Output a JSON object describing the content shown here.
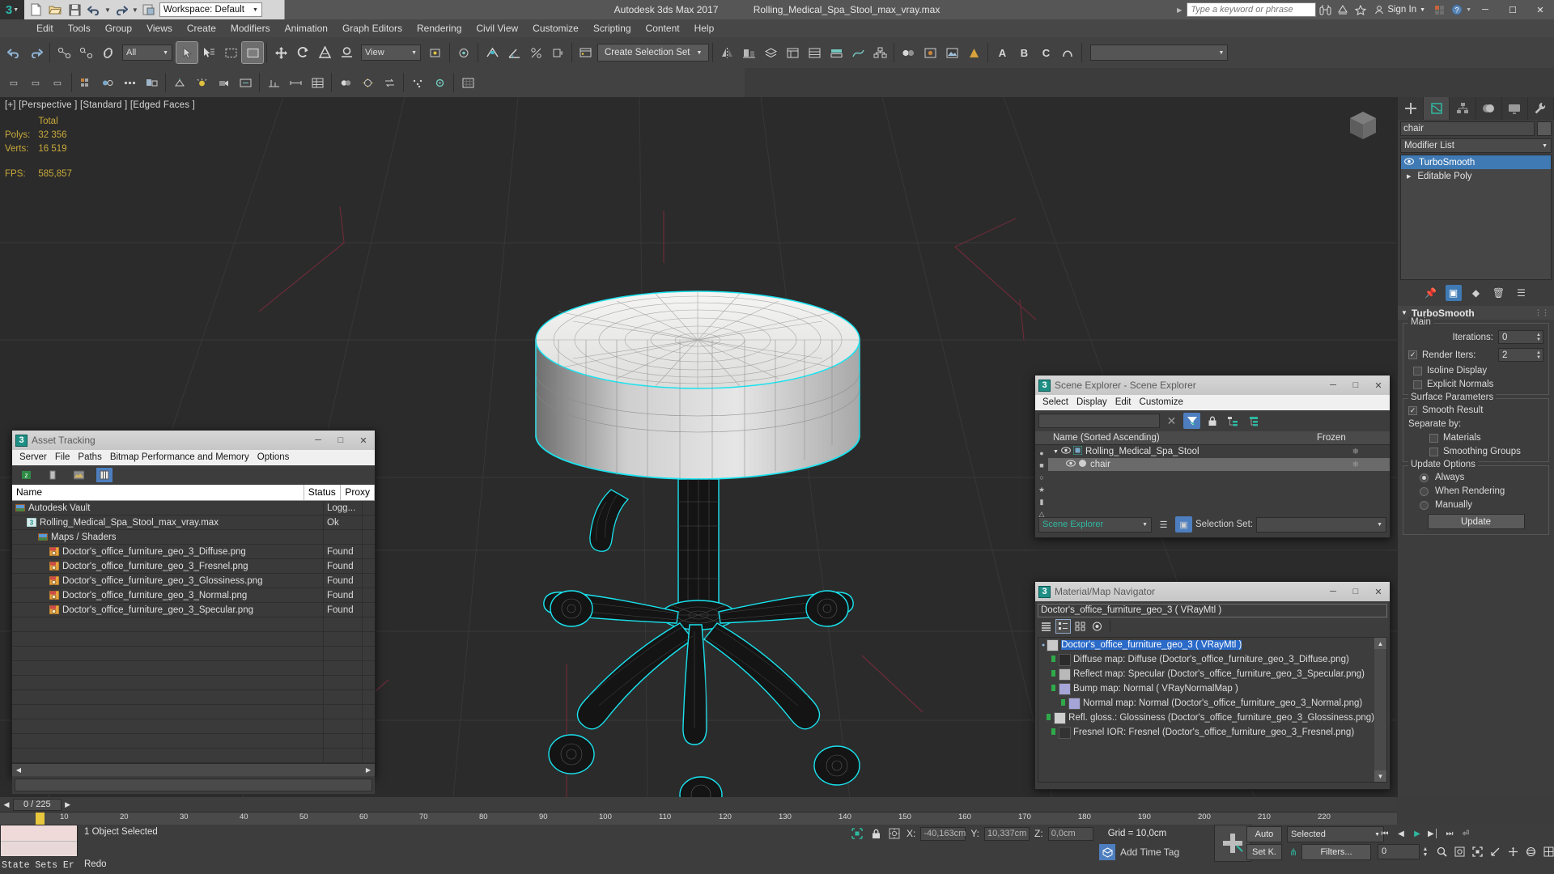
{
  "titlebar": {
    "app_icon": "3dsmax-logo-icon",
    "workspace_label": "Workspace: Default",
    "app_title": "Autodesk 3ds Max 2017",
    "file_name": "Rolling_Medical_Spa_Stool_max_vray.max",
    "search_placeholder": "Type a keyword or phrase",
    "sign_in": "Sign In",
    "minimize": "─",
    "maximize": "☐",
    "close": "✕"
  },
  "menubar": {
    "items": [
      "Edit",
      "Tools",
      "Group",
      "Views",
      "Create",
      "Modifiers",
      "Animation",
      "Graph Editors",
      "Rendering",
      "Civil View",
      "Customize",
      "Scripting",
      "Content",
      "Help"
    ]
  },
  "toolbar": {
    "selection_filter": "All",
    "view_combo": "View",
    "create_selection_set": "Create Selection Set",
    "named_set": ""
  },
  "viewport": {
    "label": "[+] [Perspective ] [Standard ] [Edged Faces ]",
    "stats_header": "Total",
    "polys_label": "Polys:",
    "polys_value": "32 356",
    "verts_label": "Verts:",
    "verts_value": "16 519",
    "fps_label": "FPS:",
    "fps_value": "585,857"
  },
  "asset_tracking": {
    "title": "Asset Tracking",
    "menu": [
      "Server",
      "File",
      "Paths",
      "Bitmap Performance and Memory",
      "Options"
    ],
    "toolbar_icons": [
      "vault-icon",
      "file-icon",
      "bitmap-icon",
      "columns-icon"
    ],
    "columns": [
      "Name",
      "Status",
      "Proxy"
    ],
    "rows": [
      {
        "name": "Autodesk Vault",
        "status": "Logg...",
        "indent": 0,
        "icon": "vault-icon"
      },
      {
        "name": "Rolling_Medical_Spa_Stool_max_vray.max",
        "status": "Ok",
        "indent": 1,
        "icon": "max-file-icon"
      },
      {
        "name": "Maps / Shaders",
        "status": "",
        "indent": 2,
        "icon": "folder-maps-icon"
      },
      {
        "name": "Doctor's_office_furniture_geo_3_Diffuse.png",
        "status": "Found",
        "indent": 3,
        "icon": "png-icon"
      },
      {
        "name": "Doctor's_office_furniture_geo_3_Fresnel.png",
        "status": "Found",
        "indent": 3,
        "icon": "png-icon"
      },
      {
        "name": "Doctor's_office_furniture_geo_3_Glossiness.png",
        "status": "Found",
        "indent": 3,
        "icon": "png-icon"
      },
      {
        "name": "Doctor's_office_furniture_geo_3_Normal.png",
        "status": "Found",
        "indent": 3,
        "icon": "png-icon"
      },
      {
        "name": "Doctor's_office_furniture_geo_3_Specular.png",
        "status": "Found",
        "indent": 3,
        "icon": "png-icon"
      }
    ]
  },
  "scene_explorer": {
    "title": "Scene Explorer - Scene Explorer",
    "menu": [
      "Select",
      "Display",
      "Edit",
      "Customize"
    ],
    "search_value": "",
    "column_name": "Name (Sorted Ascending)",
    "column_frozen": "Frozen",
    "rows": [
      {
        "name": "Rolling_Medical_Spa_Stool",
        "indent": 0,
        "selected": false,
        "frozen": "❄"
      },
      {
        "name": "chair",
        "indent": 1,
        "selected": true,
        "frozen": "❄"
      }
    ],
    "footer_combo": "Scene Explorer",
    "selection_set_label": "Selection Set:",
    "selection_set_value": ""
  },
  "material_navigator": {
    "title": "Material/Map Navigator",
    "field_value": "Doctor's_office_furniture_geo_3  ( VRayMtl )",
    "view_modes": [
      "list-view-icon",
      "detail-view-icon",
      "small-icon-view-icon",
      "large-icon-view-icon"
    ],
    "rows": [
      {
        "text": "Doctor's_office_furniture_geo_3  ( VRayMtl )",
        "indent": 0,
        "selected": true,
        "swatch": "#c9c9c9"
      },
      {
        "text": "Diffuse map: Diffuse (Doctor's_office_furniture_geo_3_Diffuse.png)",
        "indent": 1,
        "selected": false,
        "swatch": "#2b2b2b"
      },
      {
        "text": "Reflect map: Specular (Doctor's_office_furniture_geo_3_Specular.png)",
        "indent": 1,
        "selected": false,
        "swatch": "#b9b9b9"
      },
      {
        "text": "Bump map: Normal  ( VRayNormalMap )",
        "indent": 1,
        "selected": false,
        "swatch": "#a5a5d8"
      },
      {
        "text": "Normal map: Normal (Doctor's_office_furniture_geo_3_Normal.png)",
        "indent": 2,
        "selected": false,
        "swatch": "#a5a5d8"
      },
      {
        "text": "Refl. gloss.: Glossiness (Doctor's_office_furniture_geo_3_Glossiness.png)",
        "indent": 1,
        "selected": false,
        "swatch": "#cfcfcf"
      },
      {
        "text": "Fresnel IOR: Fresnel (Doctor's_office_furniture_geo_3_Fresnel.png)",
        "indent": 1,
        "selected": false,
        "swatch": "#333333"
      }
    ]
  },
  "command_panel": {
    "tabs": [
      "create-tab",
      "modify-tab",
      "hierarchy-tab",
      "motion-tab",
      "display-tab",
      "utilities-tab"
    ],
    "active_tab_index": 1,
    "object_name": "chair",
    "modifier_list_label": "Modifier List",
    "stack": [
      {
        "label": "TurboSmooth",
        "selected": true,
        "eye": true
      },
      {
        "label": "Editable Poly",
        "selected": false,
        "eye": false
      }
    ],
    "rollout_title": "TurboSmooth",
    "main_group": "Main",
    "iterations_label": "Iterations:",
    "iterations_value": "0",
    "render_iters_label": "Render Iters:",
    "render_iters_value": "2",
    "render_iters_checked": true,
    "isoline_label": "Isoline Display",
    "isoline_checked": false,
    "explicit_label": "Explicit Normals",
    "explicit_checked": false,
    "surface_group": "Surface Parameters",
    "smooth_result_label": "Smooth Result",
    "smooth_result_checked": true,
    "separate_by_label": "Separate by:",
    "materials_label": "Materials",
    "materials_checked": false,
    "smoothing_groups_label": "Smoothing Groups",
    "smoothing_groups_checked": false,
    "update_group": "Update Options",
    "update_options": [
      {
        "label": "Always",
        "selected": true
      },
      {
        "label": "When Rendering",
        "selected": false
      },
      {
        "label": "Manually",
        "selected": false
      }
    ],
    "update_button": "Update"
  },
  "timeline": {
    "frame_indicator": "0 / 225",
    "ticks": [
      "10",
      "20",
      "30",
      "40",
      "50",
      "60",
      "70",
      "80",
      "90",
      "100",
      "110",
      "120",
      "130",
      "140",
      "150",
      "160",
      "170",
      "180",
      "190",
      "200",
      "210",
      "220"
    ]
  },
  "statusbar": {
    "state_sets": "State Sets  Er",
    "prompt_selected": "1 Object Selected",
    "prompt_action": "Redo",
    "x_label": "X:",
    "x_value": "-40,163cm",
    "y_label": "Y:",
    "y_value": "10,337cm",
    "z_label": "Z:",
    "z_value": "0,0cm",
    "grid_text": "Grid = 10,0cm",
    "add_time_tag": "Add Time Tag",
    "auto_key": "Auto",
    "set_key": "Set K.",
    "selected_combo": "Selected",
    "filters_button": "Filters...",
    "frame_field": "0"
  },
  "colors": {
    "accent_teal": "#2fb8a0",
    "selection_blue": "#3f7ab5",
    "highlight_blue": "#2a6ac8",
    "viewport_bg": "#2b2b2b",
    "stats_yellow": "#c8a93b",
    "wire_cyan": "#19e3ef"
  }
}
